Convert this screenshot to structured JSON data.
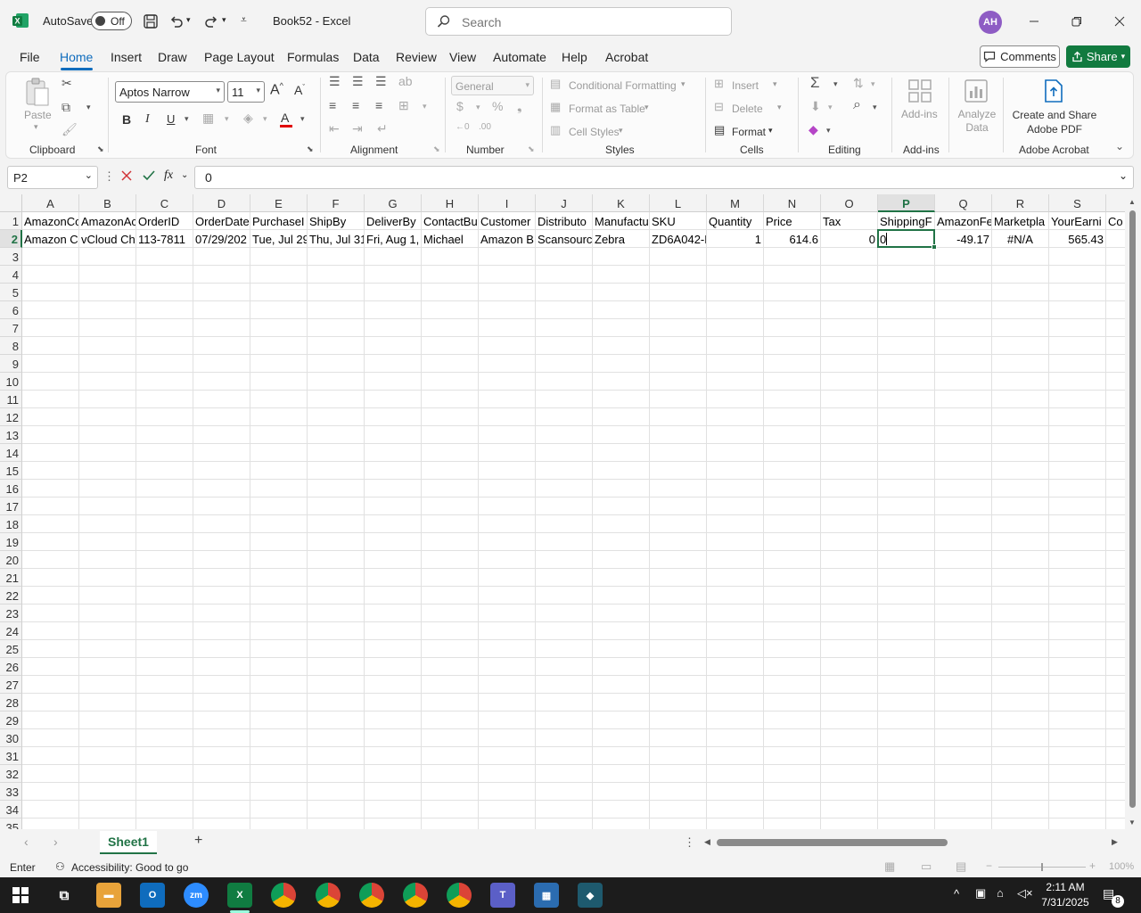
{
  "window": {
    "autosave_label": "AutoSave",
    "autosave_state": "Off",
    "doc_title": "Book52 - Excel",
    "search_placeholder": "Search",
    "avatar_initials": "AH"
  },
  "ribbon_tabs": [
    "File",
    "Home",
    "Insert",
    "Draw",
    "Page Layout",
    "Formulas",
    "Data",
    "Review",
    "View",
    "Automate",
    "Help",
    "Acrobat"
  ],
  "active_tab": "Home",
  "buttons": {
    "comments": "Comments",
    "share": "Share"
  },
  "ribbon": {
    "clipboard": {
      "label": "Clipboard",
      "paste": "Paste"
    },
    "font": {
      "label": "Font",
      "name": "Aptos Narrow",
      "size": "11"
    },
    "alignment": {
      "label": "Alignment"
    },
    "number": {
      "label": "Number",
      "format": "General"
    },
    "styles": {
      "label": "Styles",
      "conditional": "Conditional Formatting",
      "format_table": "Format as Table",
      "cell_styles": "Cell Styles"
    },
    "cells": {
      "label": "Cells",
      "insert": "Insert",
      "delete": "Delete",
      "format": "Format"
    },
    "editing": {
      "label": "Editing"
    },
    "addins": {
      "label": "Add-ins",
      "addins_btn": "Add-ins",
      "analyze": "Analyze Data"
    },
    "acrobat": {
      "label": "Adobe Acrobat",
      "create_share": "Create and Share Adobe PDF"
    }
  },
  "formula_bar": {
    "name_box": "P2",
    "formula": "0"
  },
  "sheet": {
    "columns": [
      "A",
      "B",
      "C",
      "D",
      "E",
      "F",
      "G",
      "H",
      "I",
      "J",
      "K",
      "L",
      "M",
      "N",
      "O",
      "P",
      "Q",
      "R",
      "S"
    ],
    "selected_column": "P",
    "row_count": 35,
    "selected_row": 2,
    "row1": [
      "AmazonCo",
      "AmazonAc",
      "OrderID",
      "OrderDate",
      "PurchaseI",
      "ShipBy",
      "DeliverBy",
      "ContactBu",
      "Customer",
      "Distributo",
      "Manufactu",
      "SKU",
      "Quantity",
      "Price",
      "Tax",
      "ShippingF",
      "AmazonFe",
      "Marketpla",
      "YourEarni",
      "Co"
    ],
    "row2": [
      "Amazon C",
      "vCloud Ch",
      "113-7811",
      "07/29/202",
      "Tue, Jul 29",
      "Thu, Jul 31",
      "Fri, Aug 1,",
      "Michael",
      "Amazon B",
      "Scansourc",
      "Zebra",
      "ZD6A042-D",
      "1",
      "614.6",
      "0",
      "0",
      "-49.17",
      "#N/A",
      "565.43",
      ""
    ]
  },
  "sheet_tabs": [
    "Sheet1"
  ],
  "status": {
    "mode": "Enter",
    "accessibility": "Accessibility: Good to go",
    "zoom": "100%"
  },
  "taskbar": {
    "time": "2:11 AM",
    "date": "7/31/2025",
    "notifications": "8"
  },
  "colors": {
    "excel_green": "#217346",
    "accent_blue": "#0f6cbd",
    "share_green": "#117a3f"
  }
}
